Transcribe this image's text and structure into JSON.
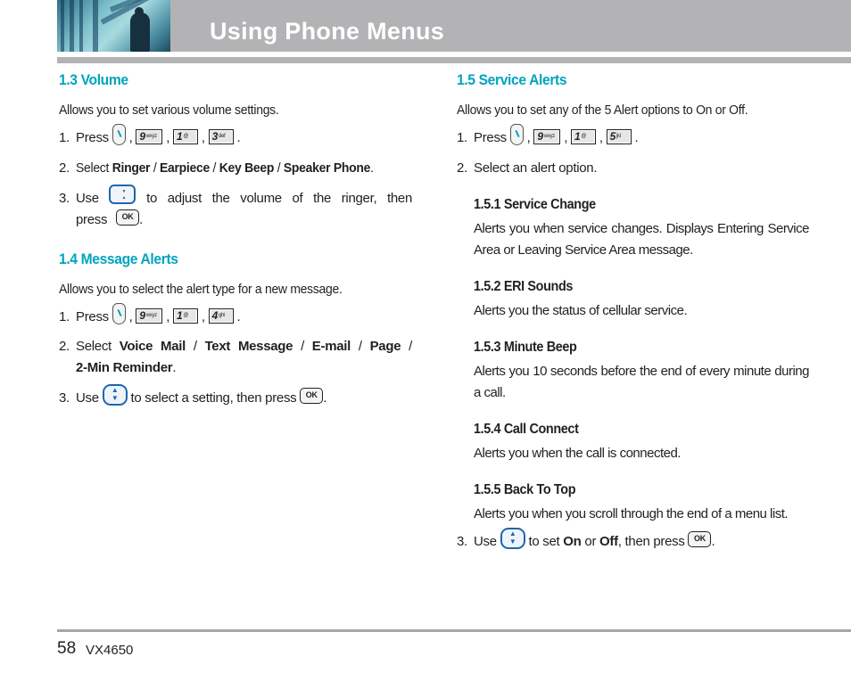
{
  "header": {
    "title": "Using Phone Menus",
    "photo": "business-person-photo"
  },
  "keys": {
    "menu": "menu-key-icon",
    "k9": {
      "digit": "9",
      "letters": "wxyz"
    },
    "k1": {
      "digit": "1",
      "letters": "@"
    },
    "k3": {
      "digit": "3",
      "letters": "def"
    },
    "k4": {
      "digit": "4",
      "letters": "ghi"
    },
    "k5": {
      "digit": "5",
      "letters": "jkl"
    },
    "ok": "OK"
  },
  "left": {
    "volume": {
      "heading": "1.3 Volume",
      "intro": "Allows you to set various volume settings.",
      "step1": {
        "num": "1.",
        "text": "Press",
        "sep": ",",
        "end": "."
      },
      "step2": {
        "num": "2.",
        "text": "Select",
        "options": [
          "Ringer",
          "Earpiece",
          "Key Beep",
          "Speaker Phone"
        ],
        "slash": " / ",
        "end": "."
      },
      "step3": {
        "num": "3.",
        "pre": "Use",
        "mid": "to adjust the volume of the ringer, then press",
        "end": "."
      }
    },
    "message_alerts": {
      "heading": "1.4 Message Alerts",
      "intro": "Allows you to select the alert type for a new message.",
      "step1": {
        "num": "1.",
        "text": "Press",
        "sep": ",",
        "end": "."
      },
      "step2": {
        "num": "2.",
        "text": "Select",
        "options": [
          "Voice Mail",
          "Text Message",
          "E-mail",
          "Page",
          "2-Min Reminder"
        ],
        "slash": " / ",
        "end": "."
      },
      "step3": {
        "num": "3.",
        "pre": "Use",
        "mid": "to select a setting, then press",
        "end": "."
      }
    }
  },
  "right": {
    "service_alerts": {
      "heading": "1.5 Service Alerts",
      "intro": "Allows you to set any of the 5 Alert options to On or Off.",
      "step1": {
        "num": "1.",
        "text": "Press",
        "sep": ",",
        "end": "."
      },
      "step2": {
        "num": "2.",
        "text": "Select an alert option."
      },
      "subsections": [
        {
          "num": "1.5.1",
          "title": "Service Change",
          "text": "Alerts you when service changes. Displays Entering Service Area or Leaving Service Area message."
        },
        {
          "num": "1.5.2",
          "title": "ERI Sounds",
          "text": "Alerts you the status of cellular service."
        },
        {
          "num": "1.5.3",
          "title": "Minute Beep",
          "text": "Alerts you 10 seconds before the end of every minute during a call."
        },
        {
          "num": "1.5.4",
          "title": "Call Connect",
          "text": "Alerts you when the call is connected."
        },
        {
          "num": "1.5.5",
          "title": "Back To Top",
          "text": "Alerts you when you scroll through the end of a menu list."
        }
      ],
      "step3": {
        "num": "3.",
        "pre": "Use",
        "mid1": "to set",
        "on": "On",
        "or": "or",
        "off": "Off",
        "mid2": ", then press",
        "end": "."
      }
    }
  },
  "footer": {
    "page_number": "58",
    "model": "VX4650"
  }
}
